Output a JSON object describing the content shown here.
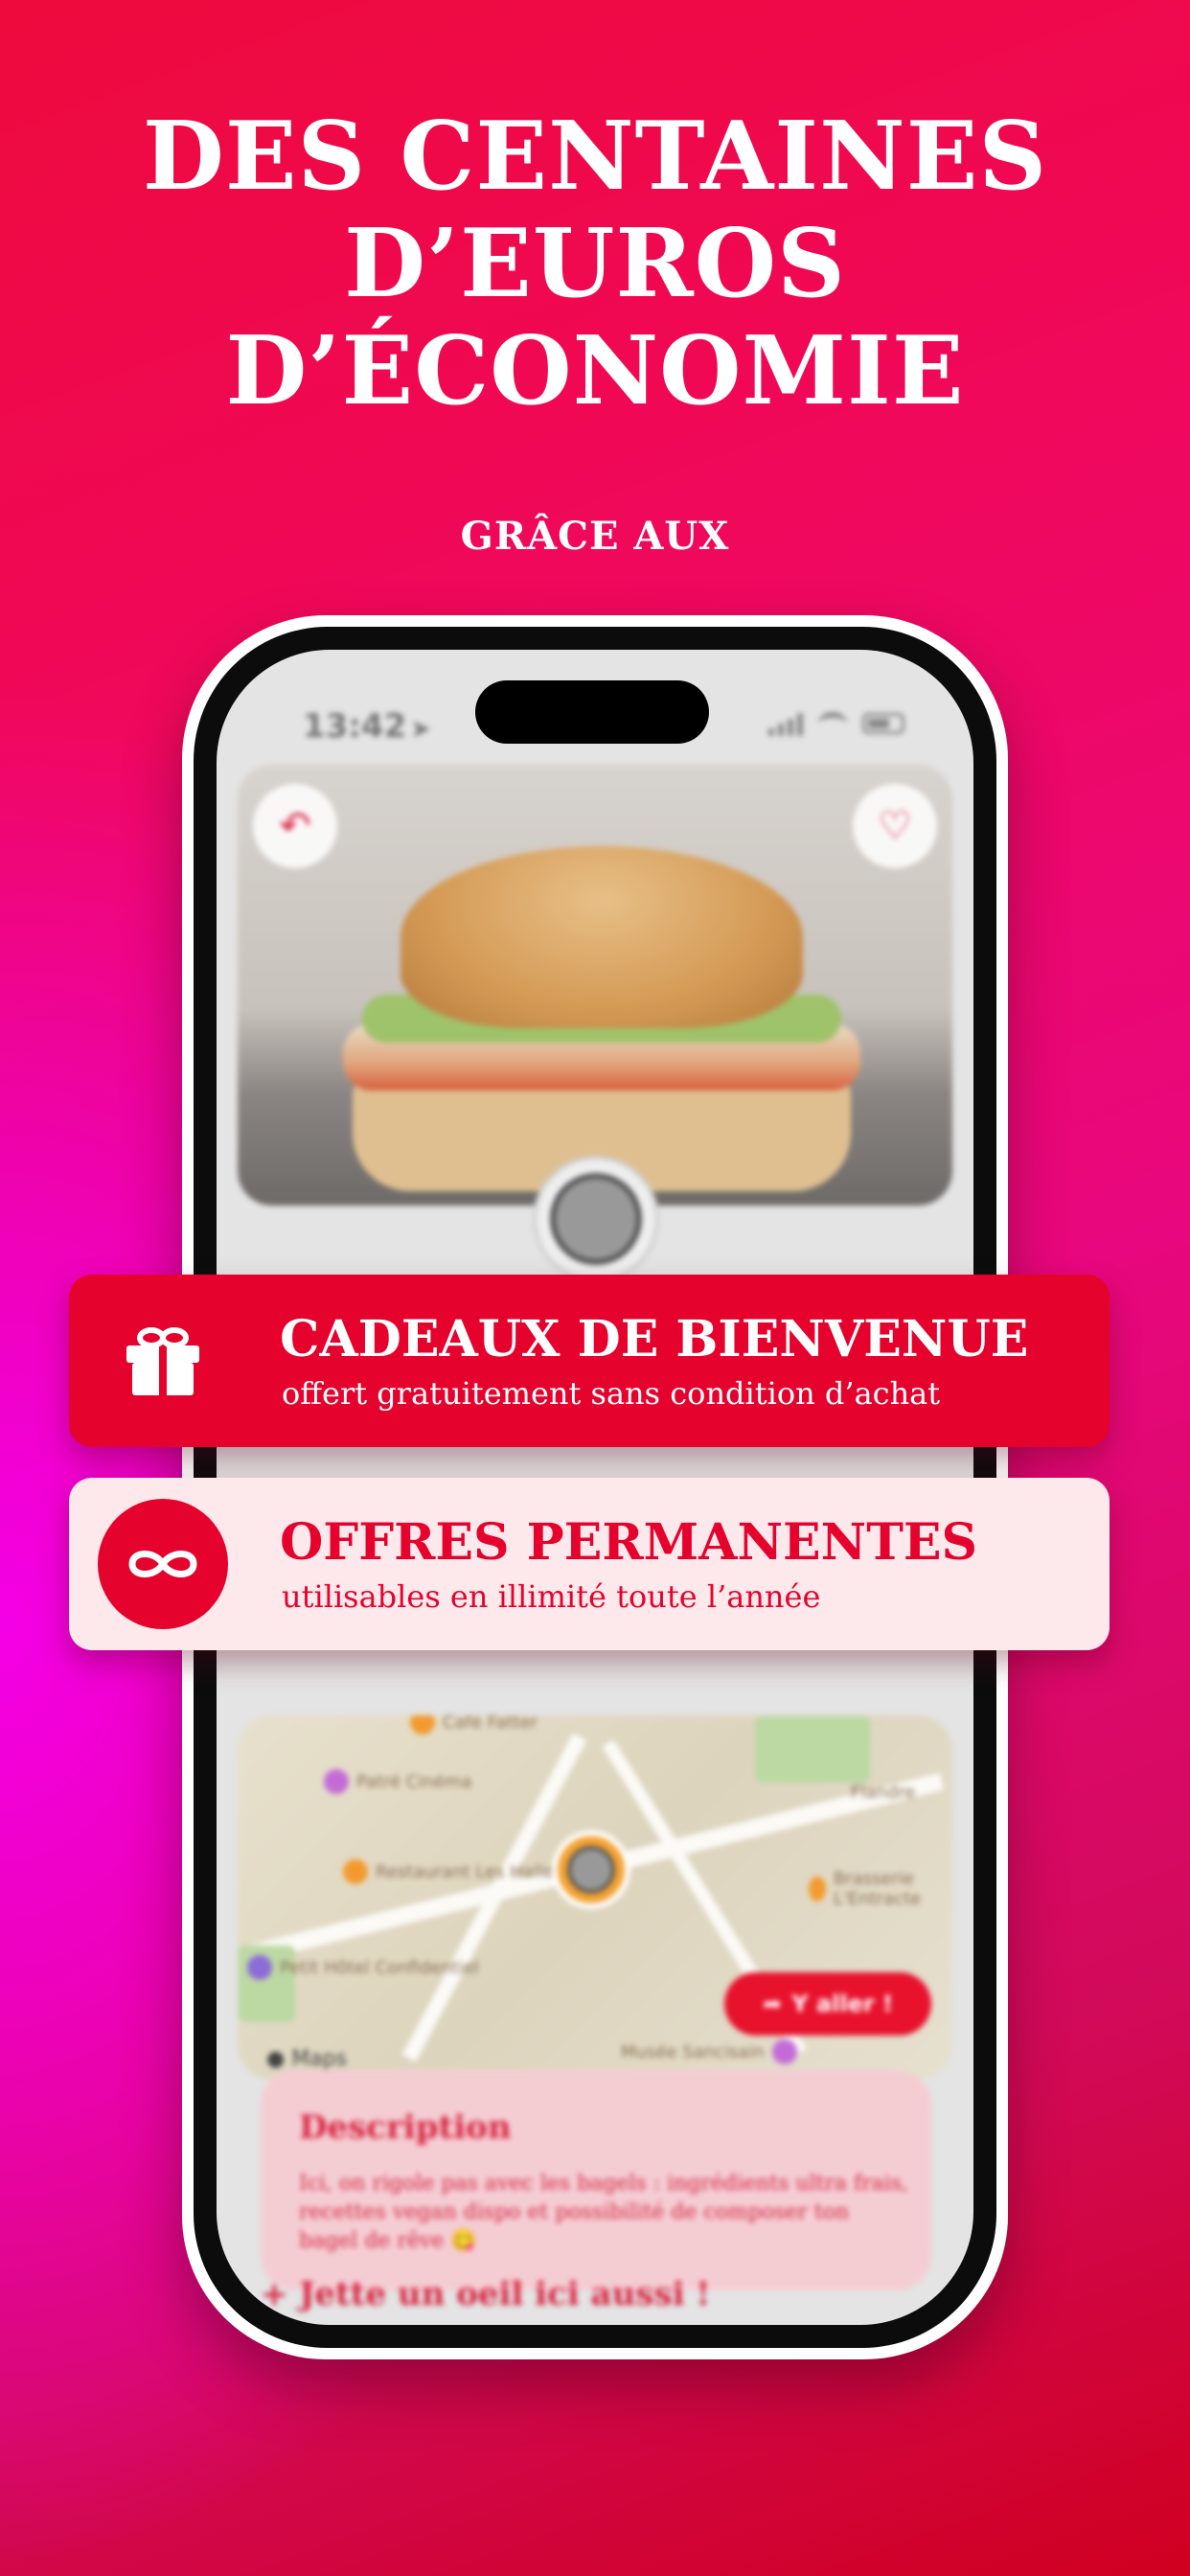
{
  "headline": {
    "line1": "DES CENTAINES",
    "line2": "D’EUROS",
    "line3": "D’ÉCONOMIE"
  },
  "subheadline": "GRÂCE AUX",
  "phone": {
    "status_time": "13:42",
    "map": {
      "go_button": "Y aller !",
      "maps_label": " Maps",
      "pois": [
        "Café Fatter",
        "Patré Cinéma",
        "Restaurant Les Halles",
        "Petit Hôtel Confidentiel",
        "Musée Sancisain",
        "Brasserie L'Entracte",
        "Flandre"
      ]
    },
    "description": {
      "title": "Description",
      "text": "Ici, on rigole pas avec les bagels : ingrédients ultra frais, recettes vegan dispo et possibilité de composer ton bagel de rêve 😋"
    },
    "also_look": "Jette un oeil ici aussi !"
  },
  "cards": [
    {
      "title": "CADEAUX DE BIENVENUE",
      "subtitle": "offert gratuitement sans condition d’achat",
      "icon": "gift-icon"
    },
    {
      "title": "OFFRES PERMANENTES",
      "subtitle": "utilisables en illimité toute l’année",
      "icon": "infinity-icon"
    }
  ],
  "colors": {
    "brand_red": "#e5022c",
    "card_pink": "#fde8ec",
    "text_white": "#ffffff"
  }
}
